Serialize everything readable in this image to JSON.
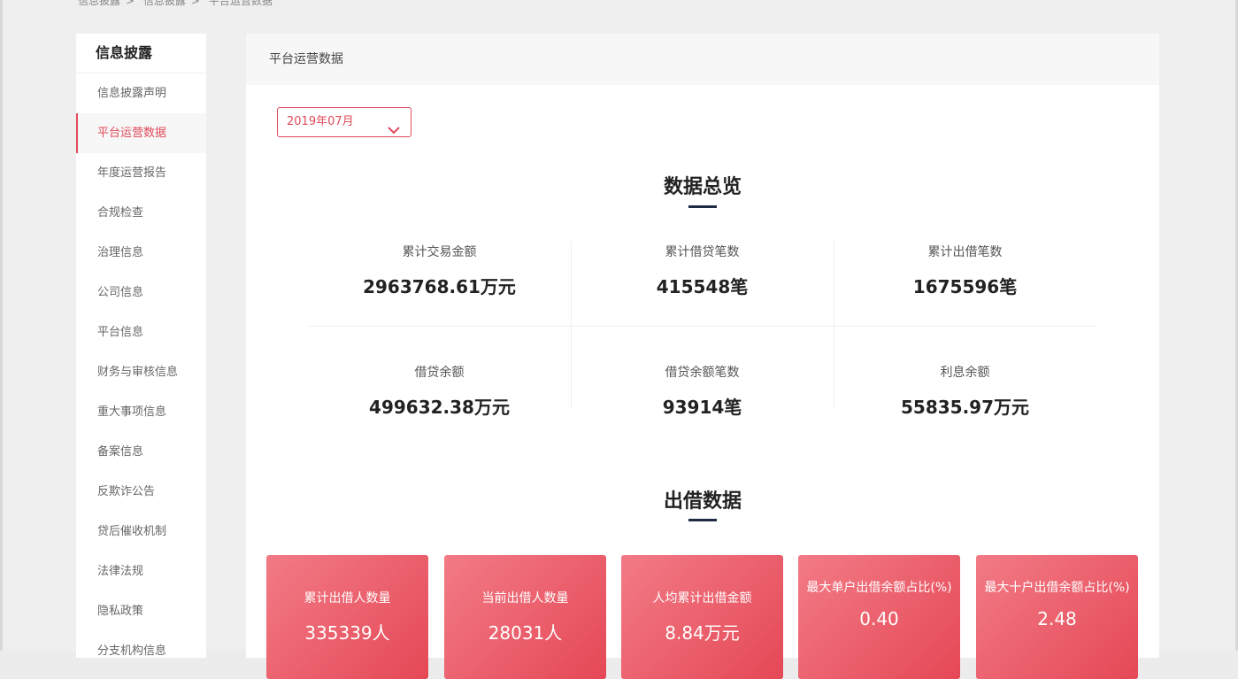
{
  "breadcrumb": [
    "信息披露",
    "信息披露",
    "平台运营数据"
  ],
  "sidebar": {
    "title": "信息披露",
    "items": [
      {
        "label": "信息披露声明",
        "active": false
      },
      {
        "label": "平台运营数据",
        "active": true
      },
      {
        "label": "年度运营报告",
        "active": false
      },
      {
        "label": "合规检查",
        "active": false
      },
      {
        "label": "治理信息",
        "active": false
      },
      {
        "label": "公司信息",
        "active": false
      },
      {
        "label": "平台信息",
        "active": false
      },
      {
        "label": "财务与审核信息",
        "active": false
      },
      {
        "label": "重大事项信息",
        "active": false
      },
      {
        "label": "备案信息",
        "active": false
      },
      {
        "label": "反欺诈公告",
        "active": false
      },
      {
        "label": "贷后催收机制",
        "active": false
      },
      {
        "label": "法律法规",
        "active": false
      },
      {
        "label": "隐私政策",
        "active": false
      },
      {
        "label": "分支机构信息",
        "active": false
      }
    ]
  },
  "main": {
    "header": "平台运营数据",
    "date_select": "2019年07月",
    "overview_title": "数据总览",
    "stats": [
      {
        "label": "累计交易金额",
        "value": "2963768.61万元"
      },
      {
        "label": "累计借贷笔数",
        "value": "415548笔"
      },
      {
        "label": "累计出借笔数",
        "value": "1675596笔"
      },
      {
        "label": "借贷余额",
        "value": "499632.38万元"
      },
      {
        "label": "借贷余额笔数",
        "value": "93914笔"
      },
      {
        "label": "利息余额",
        "value": "55835.97万元"
      }
    ],
    "lending_title": "出借数据",
    "cards": [
      {
        "label": "累计出借人数量",
        "value": "335339人"
      },
      {
        "label": "当前出借人数量",
        "value": "28031人"
      },
      {
        "label": "人均累计出借金额",
        "value": "8.84万元"
      },
      {
        "label": "最大单户出借余额占比(%)",
        "value": "0.40"
      },
      {
        "label": "最大十户出借余额占比(%)",
        "value": "2.48"
      }
    ]
  },
  "colors": {
    "accent": "#e04a5a",
    "card_gradient_start": "#f27b86",
    "card_gradient_end": "#e54856",
    "title_bar": "#1f2a44"
  }
}
